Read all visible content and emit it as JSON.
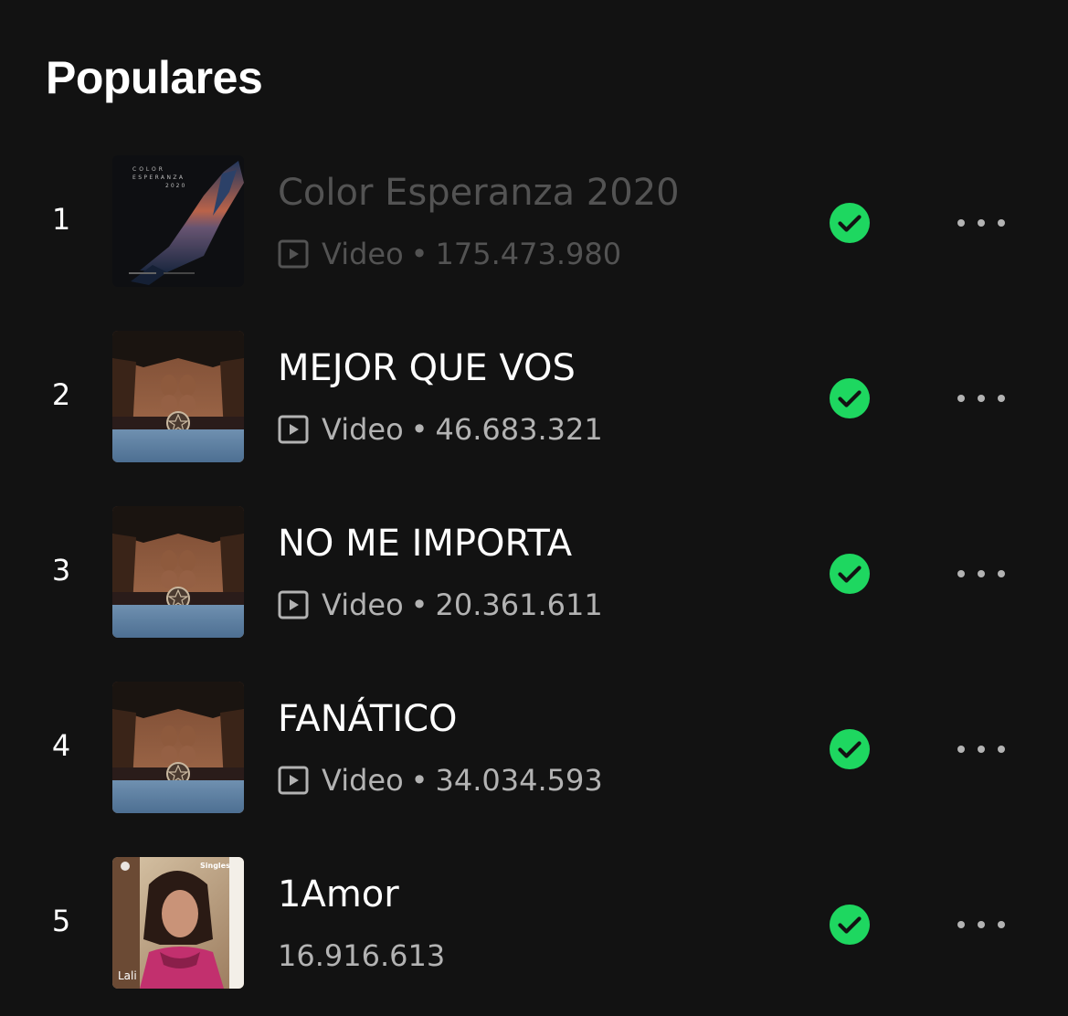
{
  "section": {
    "title": "Populares"
  },
  "colors": {
    "background": "#121212",
    "accent_green": "#1ed760",
    "text_primary": "#ffffff",
    "text_secondary": "#b3b3b3",
    "text_dimmed": "#535353"
  },
  "tracks": [
    {
      "rank": "1",
      "title": "Color Esperanza 2020",
      "type": "Video",
      "separator": "•",
      "plays": "175.473.980",
      "saved": true,
      "dimmed": true,
      "cover": "color-esperanza-cover",
      "cover_text": {
        "line1": "COLOR",
        "line2": "ESPERANZA",
        "line3": "2020"
      }
    },
    {
      "rank": "2",
      "title": "MEJOR QUE VOS",
      "type": "Video",
      "separator": "•",
      "plays": "46.683.321",
      "saved": true,
      "dimmed": false,
      "cover": "lali-belt-cover"
    },
    {
      "rank": "3",
      "title": "NO ME IMPORTA",
      "type": "Video",
      "separator": "•",
      "plays": "20.361.611",
      "saved": true,
      "dimmed": false,
      "cover": "lali-belt-cover"
    },
    {
      "rank": "4",
      "title": "FANÁTICO",
      "type": "Video",
      "separator": "•",
      "plays": "34.034.593",
      "saved": true,
      "dimmed": false,
      "cover": "lali-belt-cover"
    },
    {
      "rank": "5",
      "title": "1Amor",
      "plays": "16.916.613",
      "saved": true,
      "dimmed": false,
      "cover": "spotify-singles-cover",
      "cover_text": {
        "badge": "Singles",
        "artist": "Lali"
      }
    }
  ],
  "icons": {
    "video": "video-play-icon",
    "saved": "check-circle-icon",
    "more": "more-horizontal-icon"
  }
}
